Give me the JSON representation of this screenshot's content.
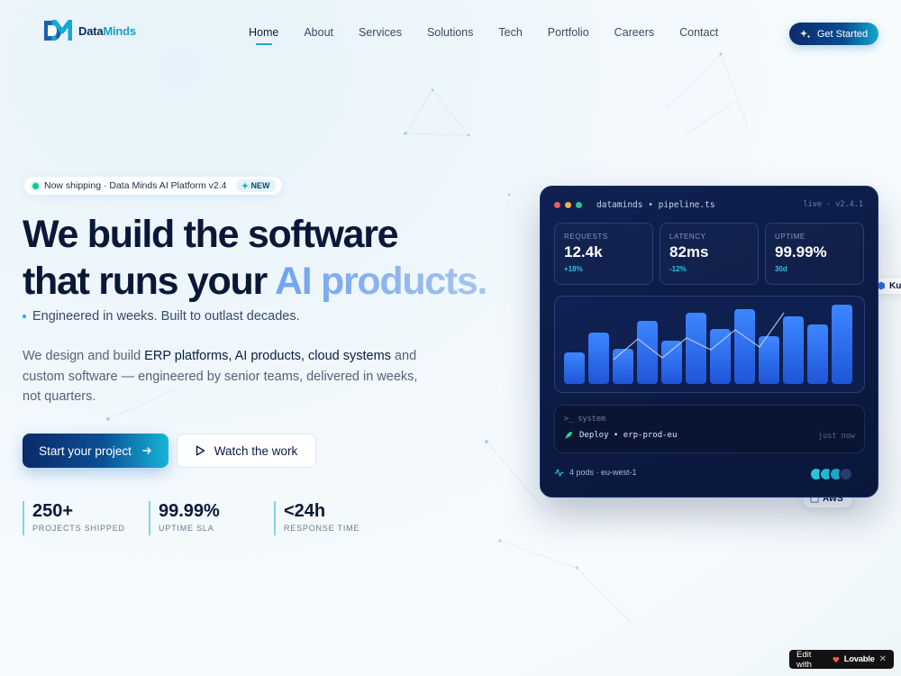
{
  "logo": {
    "name_part1": "Data",
    "name_part2": "Minds",
    "mark": "DM"
  },
  "nav": {
    "items": [
      {
        "label": "Home"
      },
      {
        "label": "About"
      },
      {
        "label": "Services"
      },
      {
        "label": "Solutions"
      },
      {
        "label": "Tech"
      },
      {
        "label": "Portfolio"
      },
      {
        "label": "Careers"
      },
      {
        "label": "Contact"
      }
    ],
    "active": "Home",
    "cta": "Get Started"
  },
  "hero": {
    "badge_text": "Now shipping · Data Minds AI Platform v2.4",
    "badge_new": "NEW",
    "headline_line1": "We build the software",
    "headline_line2": "that runs your",
    "headline_highlight": "AI products.",
    "tagline": "Engineered in weeks. Built to outlast decades.",
    "desc_part1": "We design and build ",
    "desc_strong": "ERP platforms, AI products, cloud systems",
    "desc_part2": " and custom software — engineered by senior teams, delivered in weeks, not quarters.",
    "primary_cta": "Start your project",
    "secondary_cta": "Watch the work"
  },
  "stats": [
    {
      "value": "250+",
      "label": "PROJECTS SHIPPED"
    },
    {
      "value": "99.99%",
      "label": "UPTIME SLA"
    },
    {
      "value": "<24h",
      "label": "RESPONSE TIME"
    }
  ],
  "dashboard": {
    "filename": "dataminds • pipeline.ts",
    "live_label": "live · v2.4.1",
    "metrics": [
      {
        "label": "REQUESTS",
        "value": "12.4k",
        "delta": "+18%"
      },
      {
        "label": "LATENCY",
        "value": "82ms",
        "delta": "-12%"
      },
      {
        "label": "UPTIME",
        "value": "99.99%",
        "delta": "30d"
      }
    ],
    "terminal": {
      "prompt": ">_ system",
      "command": "Deploy • erp-prod-eu",
      "time": "just now"
    },
    "footer": "4 pods · eu-west-1",
    "colors": {
      "accent": "#2ec4e0",
      "bar": "#2f6ff0",
      "card": "#0f2151"
    }
  },
  "floating_chips": {
    "right_chip": "Kul",
    "bottom_chip": "AWS"
  },
  "lovable": {
    "prefix": "Edit with",
    "brand": "Lovable"
  }
}
